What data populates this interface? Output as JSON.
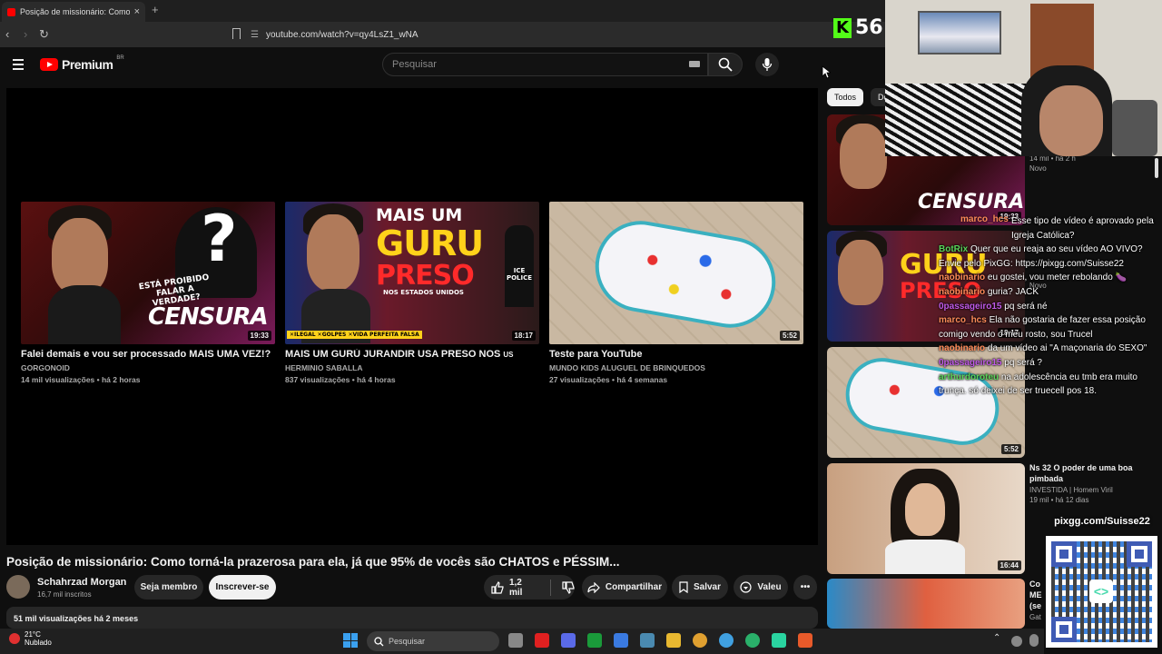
{
  "browser": {
    "tab_title": "Posição de missionário: Como to",
    "tab_close": "×",
    "new_tab": "+",
    "url": "youtube.com/watch?v=qy4LsZ1_wNA"
  },
  "youtube": {
    "logo_text": "Premium",
    "logo_region": "BR",
    "search_placeholder": "Pesquisar"
  },
  "end_screen": [
    {
      "title": "Falei demais e vou ser processado MAIS UMA VEZ!?",
      "channel": "GORGONOID",
      "meta": "14 mil visualizações • há 2 horas",
      "duration": "19:33",
      "overlay_top": "ESTÁ PROIBIDO FALAR A VERDADE?",
      "overlay_main": "CENSURA"
    },
    {
      "title": "MAIS UM GURÚ JURANDIR USA PRESO NOS",
      "title_suffix": "US",
      "channel": "HERMINIO SABALLA",
      "meta": "837 visualizações • há 4 horas",
      "duration": "18:17",
      "overlay_a": "MAIS UM",
      "overlay_b": "GURU",
      "overlay_c": "PRESO",
      "overlay_d": "NOS ESTADOS UNIDOS",
      "overlay_e": "✕ILEGAL ✕GOLPES ✕VIDA PERFEITA FALSA",
      "overlay_ice": "ICE POLICE"
    },
    {
      "title": "Teste para YouTube",
      "channel": "MUNDO KIDS ALUGUEL DE BRINQUEDOS",
      "meta": "27 visualizações • há 4 semanas",
      "duration": "5:52"
    }
  ],
  "video": {
    "title": "Posição de missionário: Como torná-la prazerosa para ela, já que 95% de vocês são CHATOS e PÉSSIM...",
    "channel": "Schahrzad Morgan",
    "subscribers": "16,7 mil inscritos",
    "member_button": "Seja membro",
    "subscribe_button": "Inscrever-se",
    "likes": "1,2 mil",
    "share": "Compartilhar",
    "save": "Salvar",
    "thanks": "Valeu",
    "views_line": "51 mil visualizações  há 2 meses"
  },
  "chips": [
    "Todos",
    "Do"
  ],
  "recommendations": [
    {
      "duration": "19:33",
      "meta": "14 mil • há 2 h",
      "badge": "Novo"
    },
    {
      "duration": "18:17",
      "badge": "Novo"
    },
    {
      "duration": "5:52"
    },
    {
      "title": "Ns 32 O poder de uma boa pimbada",
      "channel": "INVESTIDA | Homem Viril",
      "meta": "19 mil • há 12 dias",
      "duration": "16:44"
    },
    {
      "title": "Co ME (se",
      "channel": "Gat"
    }
  ],
  "kick": {
    "letter": "K",
    "viewers": "56"
  },
  "chat": [
    {
      "user": "marco_hcs",
      "text": "Esse tipo de vídeo é aprovado pela Igreja Católica?"
    },
    {
      "user": "BotRix",
      "text": "Quer que eu reaja ao seu vídeo AO VIVO? Envie pelo PixGG: https://pixgg.com/Suisse22"
    },
    {
      "user": "naobinario",
      "text": "eu gostei, vou meter rebolando 🍆"
    },
    {
      "user": "naobinario",
      "text": "guria? JACK"
    },
    {
      "user": "0passageiro15",
      "text": "pq será né"
    },
    {
      "user": "marco_hcs",
      "text": "Ela não gostaria de fazer essa posição comigo vendo o meu rosto, sou Trucel"
    },
    {
      "user": "naobinario",
      "text": "da um vídeo ai \"A maçonaria do SEXO\""
    },
    {
      "user": "0passageiro15",
      "text": "pq será ?"
    },
    {
      "user": "arthurdoroteu",
      "text": "na adolescência eu tmb era muito trunça. só deixei de ser truecell pos 18."
    }
  ],
  "pix_label": "pixgg.com/Suisse22",
  "taskbar": {
    "temp": "21°C",
    "condition": "Nublado",
    "search_placeholder": "Pesquisar"
  },
  "colors": {
    "youtube_red": "#ff0000",
    "kick_green": "#53fc18",
    "chat_user": "#ff8c5a"
  }
}
